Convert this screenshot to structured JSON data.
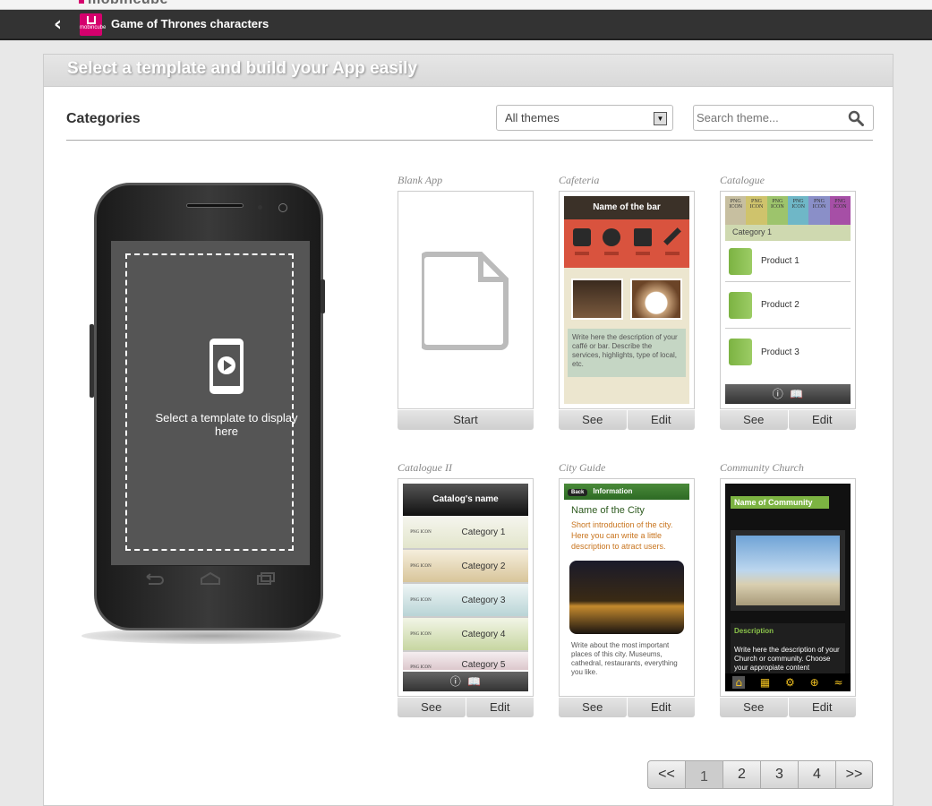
{
  "header": {
    "app_title": "Game of Thrones characters",
    "brand": "mobincube",
    "logo_text": "mobincube"
  },
  "panel": {
    "heading": "Select a template and build your App easily",
    "categories_label": "Categories"
  },
  "filter": {
    "selected": "All themes",
    "search_placeholder": "Search theme..."
  },
  "preview": {
    "text": "Select a template to display here"
  },
  "templates": [
    {
      "name": "Blank App",
      "buttons": [
        "Start"
      ]
    },
    {
      "name": "Cafeteria",
      "buttons": [
        "See",
        "Edit"
      ],
      "header": "Name of the bar",
      "desc": "Write here the description of your caffé or bar. Describe the services, highlights, type of local, etc."
    },
    {
      "name": "Catalogue",
      "buttons": [
        "See",
        "Edit"
      ],
      "category": "Category 1",
      "items": [
        "Product 1",
        "Product 2",
        "Product 3"
      ]
    },
    {
      "name": "Catalogue II",
      "buttons": [
        "See",
        "Edit"
      ],
      "header": "Catalog's name",
      "items": [
        "Category 1",
        "Category 2",
        "Category 3",
        "Category 4",
        "Category 5"
      ]
    },
    {
      "name": "City Guide",
      "buttons": [
        "See",
        "Edit"
      ],
      "back": "Back",
      "header": "Information",
      "title": "Name of the City",
      "intro": "Short introduction of the city. Here you can write a little description to atract users.",
      "desc": "Write about the most important places of this city. Museums, cathedral, restaurants, everything you like."
    },
    {
      "name": "Community Church",
      "buttons": [
        "See",
        "Edit"
      ],
      "header": "Name of Community",
      "section": "Description",
      "desc": "Write here the description of your Church or community. Choose your appropiate content"
    }
  ],
  "pager": [
    "<<",
    "1",
    "2",
    "3",
    "4",
    ">>"
  ],
  "icon_text": "PNG ICON",
  "colors": {
    "accent": "#d5006d",
    "topbar": "#333333",
    "green": "#8bc34a"
  }
}
